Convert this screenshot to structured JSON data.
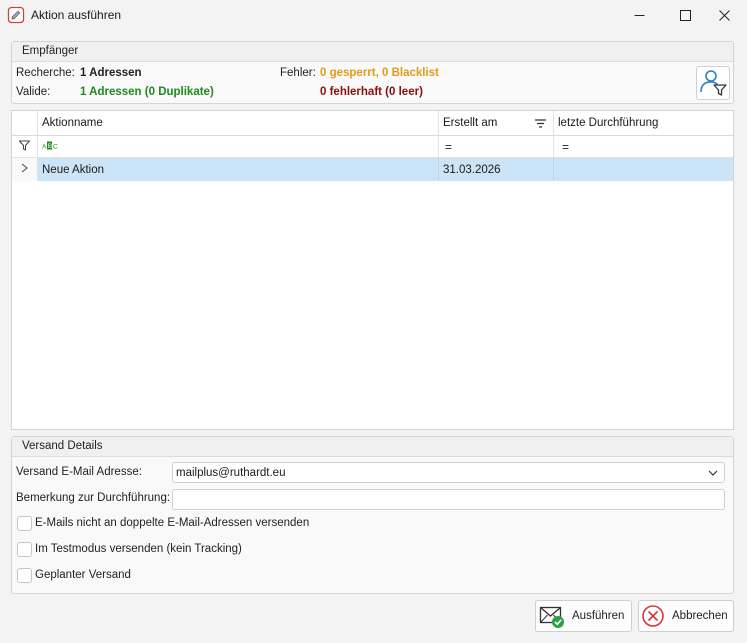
{
  "window": {
    "title": "Aktion ausführen"
  },
  "recipients": {
    "group_title": "Empfänger",
    "research_label": "Recherche:",
    "research_value": "1 Adressen",
    "valid_label": "Valide:",
    "valid_value": "1 Adressen (0 Duplikate)",
    "errors_label": "Fehler:",
    "errors_value": "0 gesperrt, 0 Blacklist",
    "faulty_value": "0 fehlerhaft (0 leer)"
  },
  "grid": {
    "columns": [
      "Aktionname",
      "Erstellt am",
      "letzte Durchführung"
    ],
    "filter_text_icon": "abc-filter-icon",
    "filter_equals": [
      "=",
      "="
    ],
    "rows": [
      {
        "name": "Neue Aktion",
        "created": "31.03.2026",
        "last_run": ""
      }
    ]
  },
  "shipping": {
    "group_title": "Versand Details",
    "email_label": "Versand E-Mail Adresse:",
    "email_value": "mailplus@ruthardt.eu",
    "remark_label": "Bemerkung zur Durchführung:",
    "remark_value": "",
    "checkbox_no_duplicates": "E-Mails nicht an doppelte E-Mail-Adressen versenden",
    "checkbox_test_mode": "Im Testmodus versenden (kein Tracking)",
    "checkbox_scheduled": "Geplanter Versand"
  },
  "buttons": {
    "execute": "Ausführen",
    "cancel": "Abbrechen"
  },
  "colors": {
    "orange": "#e39b1b",
    "green": "#1e8a1e",
    "dark_red": "#8b0e0e",
    "selection": "#cce4f7",
    "cancel_red": "#d8373a"
  }
}
